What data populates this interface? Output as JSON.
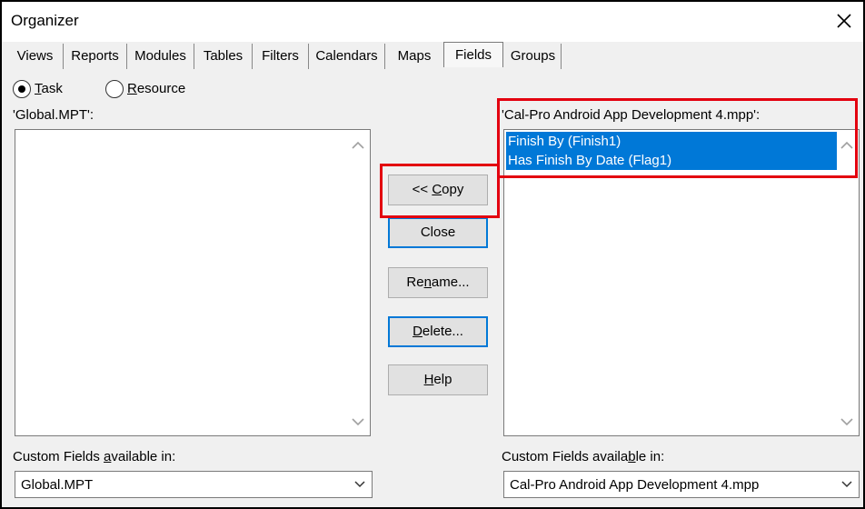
{
  "window": {
    "title": "Organizer",
    "close_icon": "close-icon"
  },
  "tabs": [
    {
      "label": "Views"
    },
    {
      "label": "Reports"
    },
    {
      "label": "Modules"
    },
    {
      "label": "Tables"
    },
    {
      "label": "Filters"
    },
    {
      "label": "Calendars"
    },
    {
      "label": "Maps"
    },
    {
      "label": "Fields",
      "active": true
    },
    {
      "label": "Groups"
    }
  ],
  "radios": {
    "task": {
      "label_first": "T",
      "label_rest": "ask",
      "selected": true
    },
    "resource": {
      "label_first": "R",
      "label_rest": "esource",
      "selected": false
    }
  },
  "left_panel": {
    "header": "'Global.MPT':",
    "items": [],
    "footer_label_pre": "Custom Fields ",
    "footer_label_u": "a",
    "footer_label_post": "vailable in:",
    "combo_value": "Global.MPT"
  },
  "right_panel": {
    "header": "'Cal-Pro Android App Development 4.mpp':",
    "items": [
      {
        "label": "Finish By (Finish1)",
        "selected": true
      },
      {
        "label": "Has Finish By Date (Flag1)",
        "selected": true
      }
    ],
    "footer_label_pre": "Custom Fields availa",
    "footer_label_u": "b",
    "footer_label_post": "le in:",
    "combo_value": "Cal-Pro Android App Development 4.mpp"
  },
  "buttons": {
    "copy": {
      "pre": "<< ",
      "u": "C",
      "post": "opy"
    },
    "close": {
      "pre": "",
      "u": "",
      "post": "Close"
    },
    "rename": {
      "pre": "Re",
      "u": "n",
      "post": "ame..."
    },
    "delete": {
      "pre": "",
      "u": "D",
      "post": "elete..."
    },
    "help": {
      "pre": "",
      "u": "H",
      "post": "elp"
    }
  },
  "colors": {
    "selection": "#0078d7",
    "highlight_box": "#e3000f"
  }
}
